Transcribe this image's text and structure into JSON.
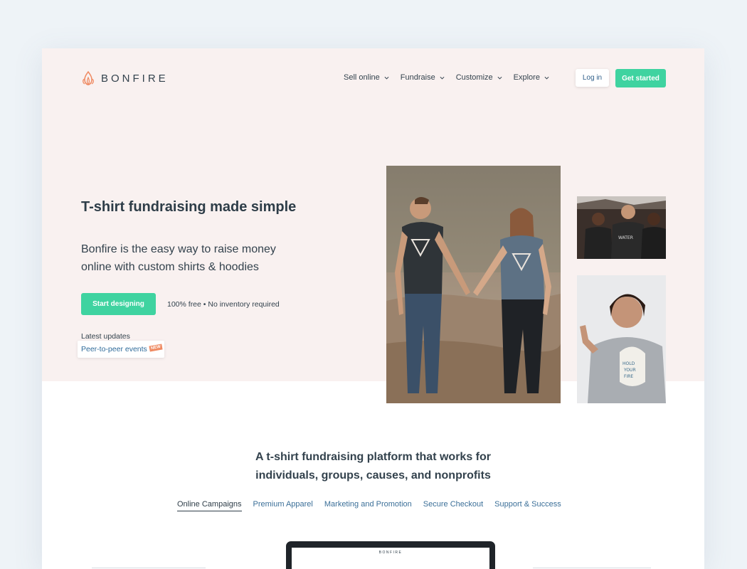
{
  "header": {
    "brand": "BONFIRE",
    "nav": [
      {
        "label": "Sell online"
      },
      {
        "label": "Fundraise"
      },
      {
        "label": "Customize"
      },
      {
        "label": "Explore"
      }
    ],
    "login_label": "Log in",
    "get_started_label": "Get started"
  },
  "hero": {
    "title": "T-shirt fundraising made simple",
    "subtitle": "Bonfire is the easy way to raise money online with custom shirts & hoodies",
    "cta_label": "Start designing",
    "cta_note": "100% free • No inventory required",
    "updates_label": "Latest updates",
    "update_link": "Peer-to-peer events",
    "update_badge": "NEW"
  },
  "platform": {
    "heading_line1": "A t-shirt fundraising platform that works for",
    "heading_line2": "individuals, groups, causes, and nonprofits",
    "tabs": [
      {
        "label": "Online Campaigns",
        "active": true
      },
      {
        "label": "Premium Apparel"
      },
      {
        "label": "Marketing and Promotion"
      },
      {
        "label": "Secure Checkout"
      },
      {
        "label": "Support & Success"
      }
    ]
  },
  "laptop": {
    "brand": "BONFIRE"
  },
  "colors": {
    "accent": "#3fd3a0",
    "hero_bg": "#f9f1f0",
    "link": "#3b6f98",
    "logo": "#ef8a62"
  }
}
